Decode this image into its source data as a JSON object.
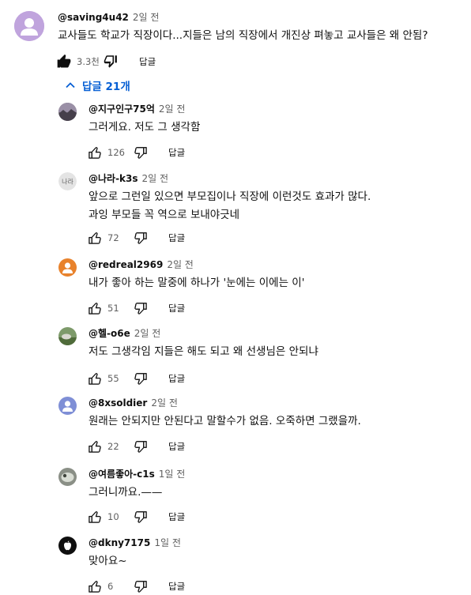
{
  "main_comment": {
    "author": "@saving4u42",
    "time": "2일 전",
    "text": "교사들도 학교가 직장이다...지들은 남의 직장에서 개진상 펴놓고 교사들은 왜 안됨?",
    "likes": "3.3천",
    "reply_label": "답글",
    "avatar_color": "#c0a4dd"
  },
  "replies_toggle": {
    "label": "답글 21개",
    "icon": "chevron-up-icon",
    "color": "#065fd4"
  },
  "replies": [
    {
      "author": "@지구인구75억",
      "time": "2일 전",
      "lines": [
        "그러게요. 저도 그 생각함"
      ],
      "likes": "126",
      "reply_label": "답글",
      "avatar": "landscape"
    },
    {
      "author": "@나라-k3s",
      "time": "2일 전",
      "lines": [
        "앞으로 그런일 있으면 부모집이나 직장에 이런것도 효과가 많다.",
        "과잉 부모들 꼭 역으로 보내야긋네"
      ],
      "likes": "72",
      "reply_label": "답글",
      "avatar": "text",
      "avatar_text": "나라"
    },
    {
      "author": "@redreal2969",
      "time": "2일 전",
      "lines": [
        "내가 좋아 하는 말중에 하나가 '눈에는 이에는 이'"
      ],
      "likes": "51",
      "reply_label": "답글",
      "avatar": "default",
      "avatar_color": "#e8822c"
    },
    {
      "author": "@헬-o6e",
      "time": "2일 전",
      "lines": [
        "저도 그생각임 지들은 해도 되고 왜 선생님은 안되냐"
      ],
      "likes": "55",
      "reply_label": "답글",
      "avatar": "photo-green"
    },
    {
      "author": "@8xsoldier",
      "time": "2일 전",
      "lines": [
        "원래는 안되지만 안된다고 말할수가 없음. 오죽하면 그랬을까."
      ],
      "likes": "22",
      "reply_label": "답글",
      "avatar": "default",
      "avatar_color": "#7f8fd6"
    },
    {
      "author": "@여름좋아-c1s",
      "time": "1일 전",
      "lines": [
        "그러니까요.——"
      ],
      "likes": "10",
      "reply_label": "답글",
      "avatar": "photo-gray"
    },
    {
      "author": "@dkny7175",
      "time": "1일 전",
      "lines": [
        "맞아요~"
      ],
      "likes": "6",
      "reply_label": "답글",
      "avatar": "apple"
    }
  ]
}
